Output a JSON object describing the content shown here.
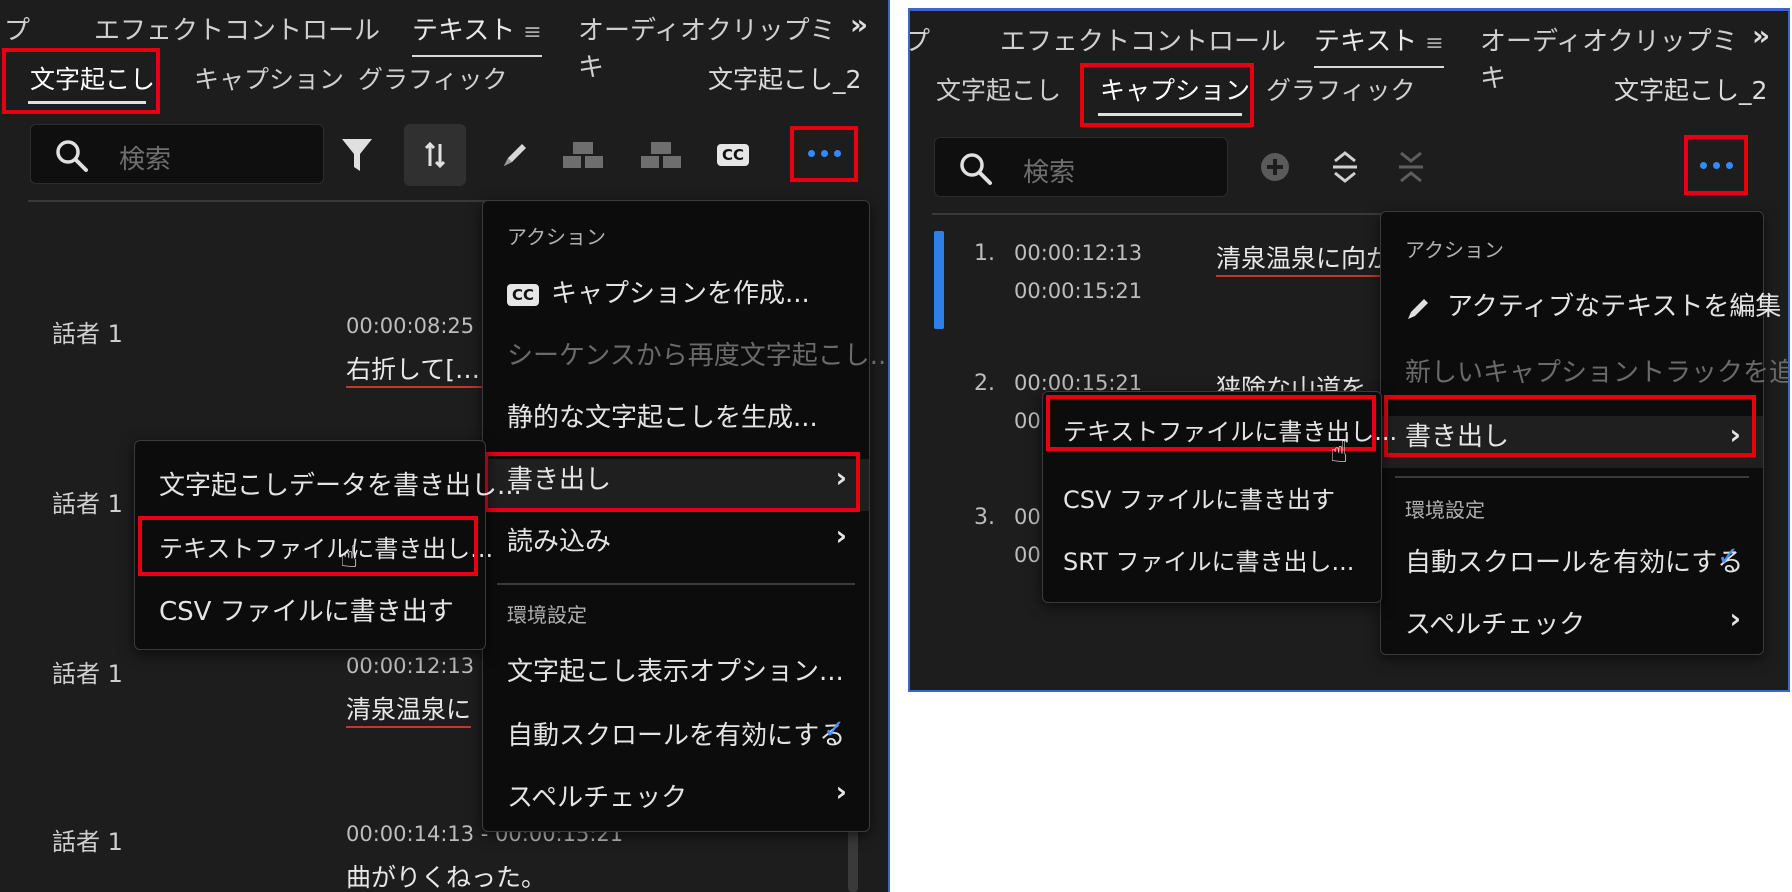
{
  "left": {
    "tabs": [
      {
        "label": "プ"
      },
      {
        "label": "エフェクトコントロール"
      },
      {
        "label": "テキスト",
        "menu": "≡"
      },
      {
        "label": "オーディオクリップミキ"
      }
    ],
    "overflow": "»",
    "subtabs": [
      "文字起こし",
      "キャプション",
      "グラフィック"
    ],
    "sequence_name": "文字起こし_2",
    "search_placeholder": "検索",
    "tools": {
      "cc": "CC"
    },
    "transcript": [
      {
        "speaker": "話者 1",
        "timecode": "00:00:08:25",
        "text": "右折して[…]"
      },
      {
        "speaker": "話者 1",
        "timecode": "",
        "text": ""
      },
      {
        "speaker": "話者 1",
        "timecode": "00:00:12:13",
        "text": "清泉温泉に"
      },
      {
        "speaker": "話者 1",
        "timecode": "00:00:14:13 - 00:00:15:21",
        "text": "曲がりくねった。"
      }
    ],
    "menu": {
      "section_action": "アクション",
      "create_caption": "キャプションを作成...",
      "retranscribe": "シーケンスから再度文字起こし...",
      "static_transcript": "静的な文字起こしを生成...",
      "export": "書き出し",
      "import": "読み込み",
      "section_prefs": "環境設定",
      "display_options": "文字起こし表示オプション...",
      "autoscroll": "自動スクロールを有効にする",
      "spellcheck": "スペルチェック",
      "check": "✓",
      "chevron": "›"
    },
    "submenu": {
      "export_transcript": "文字起こしデータを書き出し...",
      "export_text": "テキストファイルに書き出し...",
      "export_csv": "CSV ファイルに書き出す"
    }
  },
  "right": {
    "tabs": [
      {
        "label": "プ"
      },
      {
        "label": "エフェクトコントロール"
      },
      {
        "label": "テキスト",
        "menu": "≡"
      },
      {
        "label": "オーディオクリップミキ"
      }
    ],
    "overflow": "»",
    "subtabs": [
      "文字起こし",
      "キャプション",
      "グラフィック"
    ],
    "sequence_name": "文字起こし_2",
    "search_placeholder": "検索",
    "captions": [
      {
        "index": "1.",
        "start": "00:00:12:13",
        "end": "00:00:15:21",
        "text": "清泉温泉に向か"
      },
      {
        "index": "2.",
        "start": "00:00:15:21",
        "end": "00",
        "text": "狭険な山道を"
      },
      {
        "index": "3.",
        "start": "00",
        "end": "00",
        "text": ""
      }
    ],
    "menu": {
      "section_action": "アクション",
      "edit_active": "アクティブなテキストを編集",
      "add_track": "新しいキャプショントラックを追加...",
      "export": "書き出し",
      "section_prefs": "環境設定",
      "autoscroll": "自動スクロールを有効にする",
      "spellcheck": "スペルチェック",
      "check": "✓",
      "chevron": "›"
    },
    "submenu": {
      "export_text": "テキストファイルに書き出し...",
      "export_csv": "CSV ファイルに書き出す",
      "export_srt": "SRT ファイルに書き出し..."
    }
  },
  "colors": {
    "accent": "#2f8cff",
    "highlight": "#e60012",
    "panel_bg": "#1d1d1d"
  }
}
